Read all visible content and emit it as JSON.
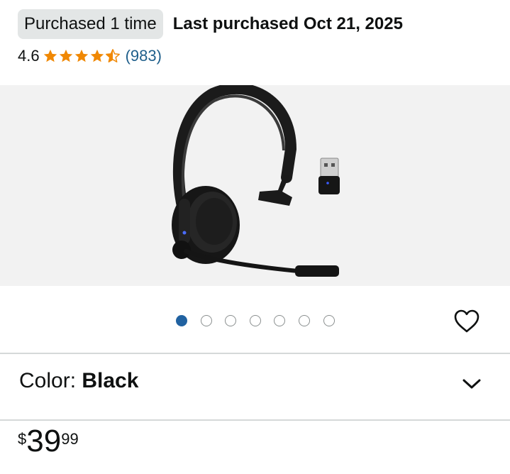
{
  "purchase": {
    "badge_label": "Purchased 1 time",
    "last_purchased": "Last purchased Oct 21, 2025"
  },
  "rating": {
    "value": "4.6",
    "stars": 4.6,
    "review_count": "(983)"
  },
  "gallery": {
    "image_alt": "Bluetooth headset with boom microphone and USB dongle",
    "total_images": 7,
    "active_index": 0
  },
  "icons": {
    "heart": "heart-icon",
    "chevron": "chevron-down-icon",
    "star": "star-icon"
  },
  "variant": {
    "label": "Color: ",
    "value": "Black"
  },
  "price": {
    "symbol": "$",
    "whole": "39",
    "fraction": "99"
  },
  "colors": {
    "star": "#f08804",
    "link": "#1f5f8b",
    "dot_active": "#2162a1",
    "badge_bg": "#e3e6e6"
  }
}
